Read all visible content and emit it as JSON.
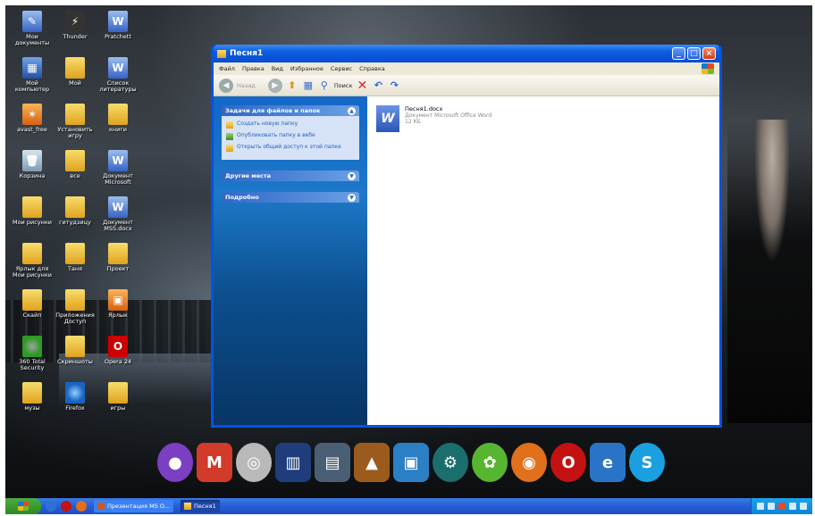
{
  "desktop": {
    "icons": [
      {
        "label": "Мои документы",
        "style": "docblue",
        "glyph": "✎"
      },
      {
        "label": "Thunder",
        "style": "dark",
        "glyph": "⚡"
      },
      {
        "label": "Pratchett",
        "style": "docblue",
        "glyph": "W"
      },
      {
        "label": "Мой компьютер",
        "style": "comp",
        "glyph": "▦"
      },
      {
        "label": "Мой",
        "style": "folder",
        "glyph": ""
      },
      {
        "label": "Список литературы",
        "style": "docblue",
        "glyph": "W"
      },
      {
        "label": "avast_free",
        "style": "orange",
        "glyph": "✶"
      },
      {
        "label": "Установить игру",
        "style": "folder",
        "glyph": ""
      },
      {
        "label": "книги",
        "style": "folder",
        "glyph": ""
      },
      {
        "label": "Корзина",
        "style": "trash",
        "glyph": "🗑"
      },
      {
        "label": "все",
        "style": "folder",
        "glyph": ""
      },
      {
        "label": "Документ Microsoft",
        "style": "docblue",
        "glyph": "W"
      },
      {
        "label": "Мои рисунки",
        "style": "folder",
        "glyph": ""
      },
      {
        "label": "гитудзицу",
        "style": "folder",
        "glyph": ""
      },
      {
        "label": "Документ MSS.docx",
        "style": "docblue",
        "glyph": "W"
      },
      {
        "label": "Ярлык для Мои рисунки",
        "style": "folder",
        "glyph": ""
      },
      {
        "label": "Таня",
        "style": "folder",
        "glyph": ""
      },
      {
        "label": "Проект",
        "style": "folder",
        "glyph": ""
      },
      {
        "label": "Скайп",
        "style": "folder",
        "glyph": ""
      },
      {
        "label": "Приложения Доступ",
        "style": "folder",
        "glyph": ""
      },
      {
        "label": "Ярлык",
        "style": "orange",
        "glyph": "▣"
      },
      {
        "label": "360 Total Security",
        "style": "green",
        "glyph": ""
      },
      {
        "label": "Скриншоты",
        "style": "folder",
        "glyph": ""
      },
      {
        "label": "Opera 24",
        "style": "opera",
        "glyph": "O"
      },
      {
        "label": "музы",
        "style": "folder",
        "glyph": ""
      },
      {
        "label": "Firefox",
        "style": "ff",
        "glyph": ""
      },
      {
        "label": "игры",
        "style": "folder",
        "glyph": ""
      }
    ]
  },
  "dock": {
    "items": [
      {
        "name": "purple-app-icon",
        "color": "#7b3fc4",
        "glyph": "●"
      },
      {
        "name": "mario-icon",
        "color": "#d23b2a",
        "glyph": "M"
      },
      {
        "name": "disc-icon",
        "color": "#b9b9b9",
        "glyph": "◎"
      },
      {
        "name": "library-icon",
        "color": "#1f3d7a",
        "glyph": "▥"
      },
      {
        "name": "briefcase-icon",
        "color": "#4a5f74",
        "glyph": "▤"
      },
      {
        "name": "wolf-icon",
        "color": "#9a5b1d",
        "glyph": "▲"
      },
      {
        "name": "monitor-icon",
        "color": "#2b7fc5",
        "glyph": "▣"
      },
      {
        "name": "network-icon",
        "color": "#1b6e6e",
        "glyph": "⚙"
      },
      {
        "name": "icq-icon",
        "color": "#58b531",
        "glyph": "✿"
      },
      {
        "name": "firefox-icon",
        "color": "#e0701c",
        "glyph": "◉"
      },
      {
        "name": "opera-icon",
        "color": "#c41212",
        "glyph": "O"
      },
      {
        "name": "ie-icon",
        "color": "#2a74c8",
        "glyph": "e"
      },
      {
        "name": "skype-icon",
        "color": "#1aa0e0",
        "glyph": "S"
      }
    ]
  },
  "window": {
    "title": "Песня1",
    "menu": [
      "Файл",
      "Правка",
      "Вид",
      "Избранное",
      "Сервис",
      "Справка"
    ],
    "toolbar": {
      "back_label": "Назад",
      "search_label": "Поиск"
    },
    "taskpane": {
      "groups": [
        {
          "title": "Задачи для файлов и папок",
          "tasks": [
            "Создать новую папку",
            "Опубликовать папку в вебе",
            "Открыть общий доступ к этой папке"
          ]
        },
        {
          "title": "Другие места",
          "tasks": []
        },
        {
          "title": "Подробно",
          "tasks": []
        }
      ]
    },
    "files": [
      {
        "name": "Песня1.docx",
        "type": "Документ Microsoft Office Word",
        "size": "12 КБ"
      }
    ]
  },
  "taskbar": {
    "buttons": [
      {
        "label": "Презентация MS O...",
        "state": "inactive"
      },
      {
        "label": "Песня1",
        "state": "active"
      }
    ]
  }
}
